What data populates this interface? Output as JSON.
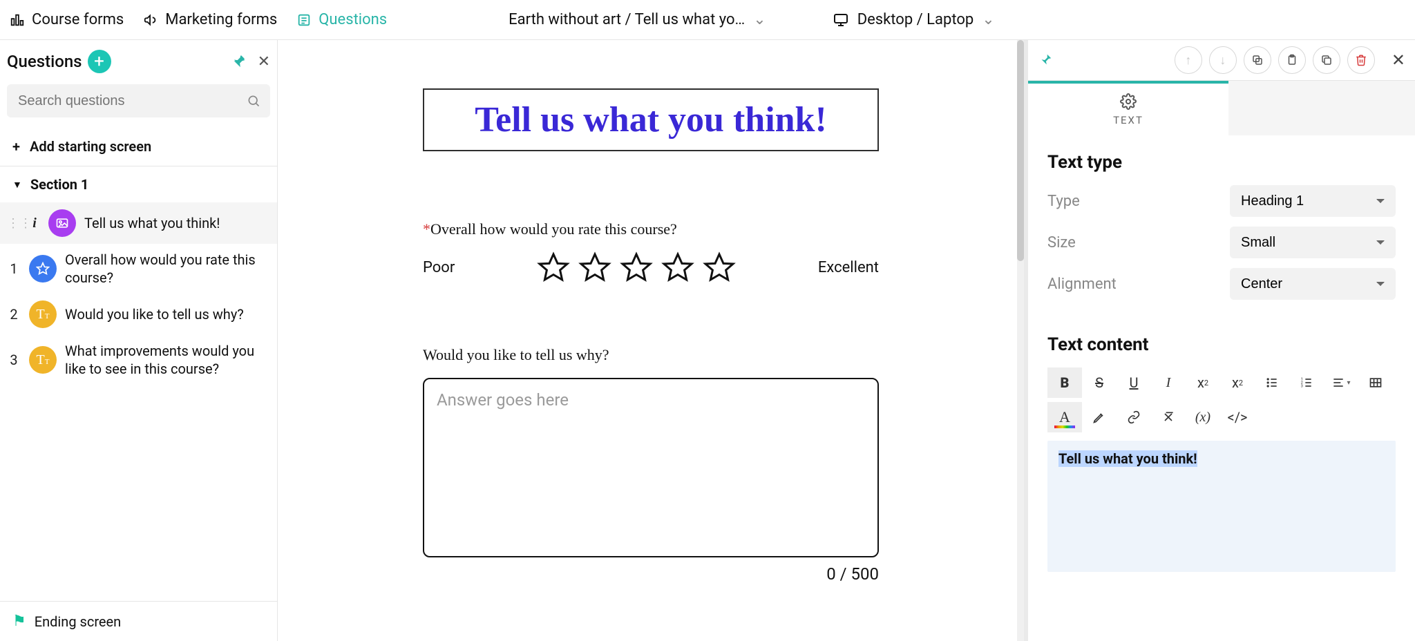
{
  "topbar": {
    "course_forms": "Course forms",
    "marketing_forms": "Marketing forms",
    "questions": "Questions",
    "breadcrumb": "Earth without art / Tell us what yo…",
    "device": "Desktop / Laptop"
  },
  "sidebar": {
    "title": "Questions",
    "search_placeholder": "Search questions",
    "add_starting": "Add starting screen",
    "section_label": "Section 1",
    "items": [
      {
        "num": "",
        "chip": "image",
        "text": "Tell us what you think!"
      },
      {
        "num": "1",
        "chip": "star",
        "text": "Overall how would you rate this course?"
      },
      {
        "num": "2",
        "chip": "text",
        "text": "Would you like to tell us why?"
      },
      {
        "num": "3",
        "chip": "text",
        "text": "What  improvements would you like to see in this course?"
      }
    ],
    "ending": "Ending screen"
  },
  "canvas": {
    "heading": "Tell us what you think!",
    "q1": "Overall how would you rate this course?",
    "poor": "Poor",
    "excellent": "Excellent",
    "q2": "Would you like to tell us why?",
    "answer_placeholder": "Answer goes here",
    "char_count": "0 / 500"
  },
  "right": {
    "tab_label": "TEXT",
    "text_type_h": "Text type",
    "type_label": "Type",
    "type_value": "Heading 1",
    "size_label": "Size",
    "size_value": "Small",
    "align_label": "Alignment",
    "align_value": "Center",
    "content_h": "Text content",
    "content_value": "Tell us what you think!"
  }
}
